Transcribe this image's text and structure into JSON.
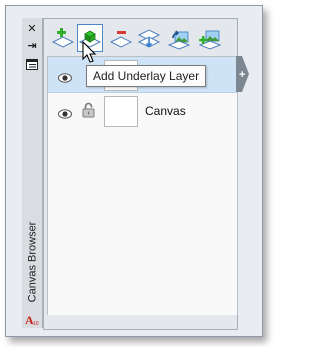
{
  "palette": {
    "title": "Canvas Browser",
    "strip_buttons": [
      {
        "icon": "close-icon",
        "glyph": "✕"
      },
      {
        "icon": "auto-hide-icon",
        "glyph": "⇥"
      },
      {
        "icon": "properties-icon",
        "glyph": "☰"
      }
    ],
    "app_icon_label": "A",
    "app_icon_sub": "10"
  },
  "toolbar": {
    "buttons": [
      {
        "name": "add-layer-button",
        "icon": "add-layer-icon"
      },
      {
        "name": "add-underlay-layer-button",
        "icon": "add-underlay-layer-icon",
        "active": true
      },
      {
        "name": "delete-layer-button",
        "icon": "delete-layer-icon"
      },
      {
        "name": "merge-down-button",
        "icon": "merge-down-icon"
      },
      {
        "name": "import-image-button",
        "icon": "import-image-icon"
      },
      {
        "name": "add-image-layer-button",
        "icon": "add-image-layer-icon"
      }
    ]
  },
  "tooltip": {
    "text": "Add Underlay Layer"
  },
  "layers": [
    {
      "name": "",
      "selected": true,
      "visible": true,
      "locked": false
    },
    {
      "name": "Canvas",
      "selected": false,
      "visible": true,
      "locked": true
    }
  ],
  "colors": {
    "selection": "#cfe3f6",
    "active_border": "#4f86c8",
    "plus_green": "#2fae2a",
    "minus_red": "#d23a2f",
    "app_red": "#c8201b"
  }
}
